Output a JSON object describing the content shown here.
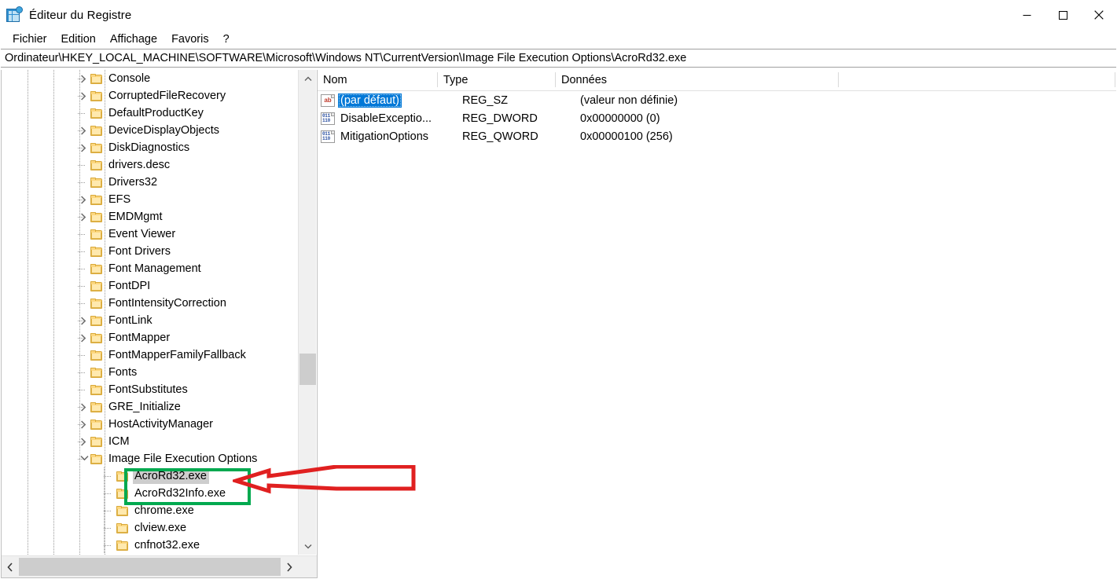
{
  "window": {
    "title": "Éditeur du Registre",
    "icon": "registry-editor-icon",
    "minimize_label": "Réduire",
    "maximize_label": "Agrandir",
    "close_label": "Fermer"
  },
  "menubar": {
    "items": [
      {
        "label": "Fichier"
      },
      {
        "label": "Edition"
      },
      {
        "label": "Affichage"
      },
      {
        "label": "Favoris"
      },
      {
        "label": "?"
      }
    ]
  },
  "address": {
    "value": "Ordinateur\\HKEY_LOCAL_MACHINE\\SOFTWARE\\Microsoft\\Windows NT\\CurrentVersion\\Image File Execution Options\\AcroRd32.exe"
  },
  "tree": {
    "items": [
      {
        "label": "Console",
        "depth": 4,
        "expandable": true,
        "expanded": false,
        "selected": false
      },
      {
        "label": "CorruptedFileRecovery",
        "depth": 4,
        "expandable": true,
        "expanded": false,
        "selected": false
      },
      {
        "label": "DefaultProductKey",
        "depth": 4,
        "expandable": false,
        "expanded": false,
        "selected": false
      },
      {
        "label": "DeviceDisplayObjects",
        "depth": 4,
        "expandable": true,
        "expanded": false,
        "selected": false
      },
      {
        "label": "DiskDiagnostics",
        "depth": 4,
        "expandable": true,
        "expanded": false,
        "selected": false
      },
      {
        "label": "drivers.desc",
        "depth": 4,
        "expandable": false,
        "expanded": false,
        "selected": false
      },
      {
        "label": "Drivers32",
        "depth": 4,
        "expandable": false,
        "expanded": false,
        "selected": false
      },
      {
        "label": "EFS",
        "depth": 4,
        "expandable": true,
        "expanded": false,
        "selected": false
      },
      {
        "label": "EMDMgmt",
        "depth": 4,
        "expandable": true,
        "expanded": false,
        "selected": false
      },
      {
        "label": "Event Viewer",
        "depth": 4,
        "expandable": false,
        "expanded": false,
        "selected": false
      },
      {
        "label": "Font Drivers",
        "depth": 4,
        "expandable": false,
        "expanded": false,
        "selected": false
      },
      {
        "label": "Font Management",
        "depth": 4,
        "expandable": false,
        "expanded": false,
        "selected": false
      },
      {
        "label": "FontDPI",
        "depth": 4,
        "expandable": false,
        "expanded": false,
        "selected": false
      },
      {
        "label": "FontIntensityCorrection",
        "depth": 4,
        "expandable": false,
        "expanded": false,
        "selected": false
      },
      {
        "label": "FontLink",
        "depth": 4,
        "expandable": true,
        "expanded": false,
        "selected": false
      },
      {
        "label": "FontMapper",
        "depth": 4,
        "expandable": true,
        "expanded": false,
        "selected": false
      },
      {
        "label": "FontMapperFamilyFallback",
        "depth": 4,
        "expandable": false,
        "expanded": false,
        "selected": false
      },
      {
        "label": "Fonts",
        "depth": 4,
        "expandable": false,
        "expanded": false,
        "selected": false
      },
      {
        "label": "FontSubstitutes",
        "depth": 4,
        "expandable": false,
        "expanded": false,
        "selected": false
      },
      {
        "label": "GRE_Initialize",
        "depth": 4,
        "expandable": true,
        "expanded": false,
        "selected": false
      },
      {
        "label": "HostActivityManager",
        "depth": 4,
        "expandable": true,
        "expanded": false,
        "selected": false
      },
      {
        "label": "ICM",
        "depth": 4,
        "expandable": true,
        "expanded": false,
        "selected": false
      },
      {
        "label": "Image File Execution Options",
        "depth": 4,
        "expandable": true,
        "expanded": true,
        "selected": false
      },
      {
        "label": "AcroRd32.exe",
        "depth": 5,
        "expandable": false,
        "expanded": false,
        "selected": true
      },
      {
        "label": "AcroRd32Info.exe",
        "depth": 5,
        "expandable": false,
        "expanded": false,
        "selected": false
      },
      {
        "label": "chrome.exe",
        "depth": 5,
        "expandable": false,
        "expanded": false,
        "selected": false
      },
      {
        "label": "clview.exe",
        "depth": 5,
        "expandable": false,
        "expanded": false,
        "selected": false
      },
      {
        "label": "cnfnot32.exe",
        "depth": 5,
        "expandable": false,
        "expanded": false,
        "selected": false
      }
    ]
  },
  "list": {
    "columns": [
      {
        "label": "Nom"
      },
      {
        "label": "Type"
      },
      {
        "label": "Données"
      },
      {
        "label": ""
      }
    ],
    "rows": [
      {
        "icon": "string-value-icon",
        "icon_text": "ab",
        "name": "(par défaut)",
        "type": "REG_SZ",
        "data": "(valeur non définie)",
        "selected": true
      },
      {
        "icon": "dword-value-icon",
        "icon_text": "011110",
        "name": "DisableExceptio...",
        "type": "REG_DWORD",
        "data": "0x00000000 (0)",
        "selected": false
      },
      {
        "icon": "qword-value-icon",
        "icon_text": "011110",
        "name": "MitigationOptions",
        "type": "REG_QWORD",
        "data": "0x00000100 (256)",
        "selected": false
      }
    ]
  },
  "annotations": {
    "highlight_color": "#00a94f",
    "arrow_color": "#e02020",
    "highlight_target": "AcroRd32.exe / AcroRd32Info.exe keys",
    "arrow_target": "AcroRd32.exe"
  },
  "scrollbars": {
    "tree_vertical": "tree-vertical-scrollbar",
    "tree_horizontal": "tree-horizontal-scrollbar"
  }
}
